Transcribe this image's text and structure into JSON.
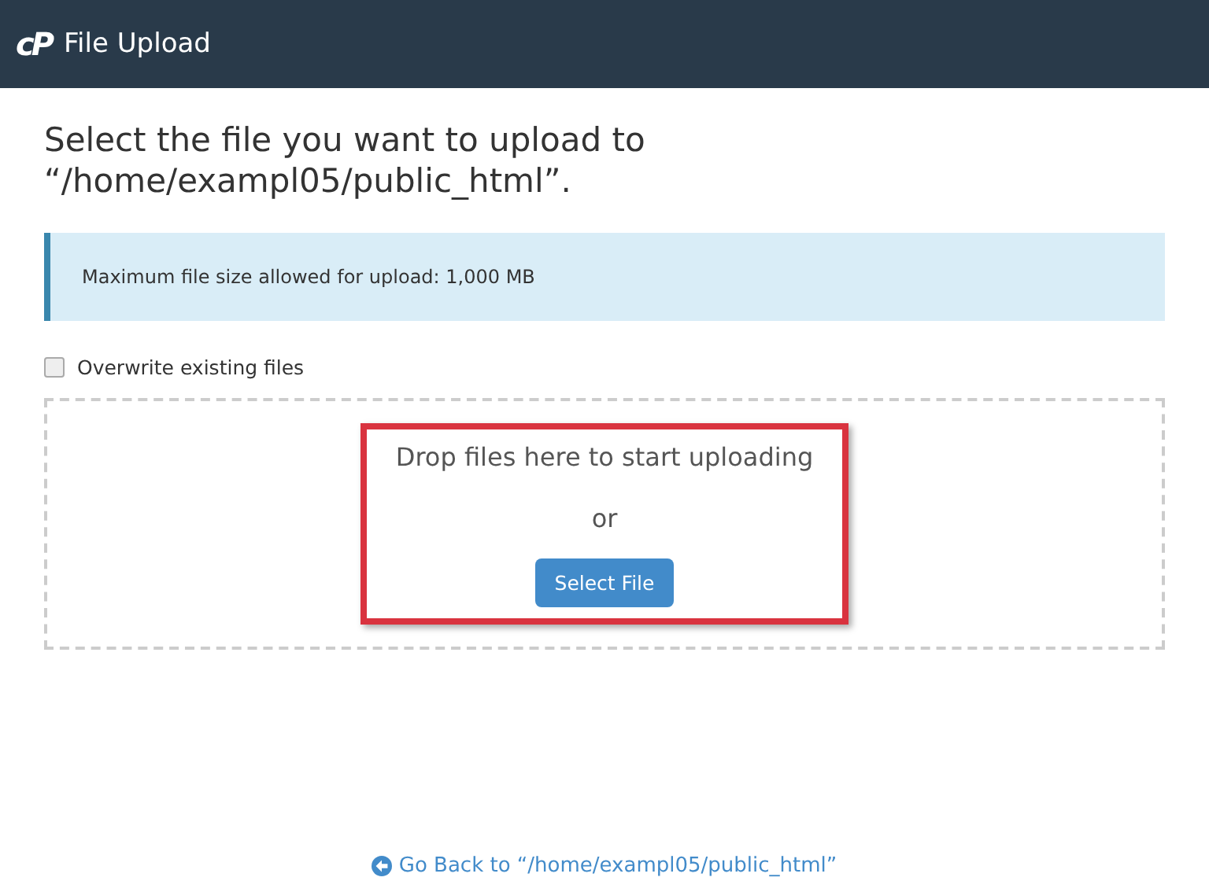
{
  "header": {
    "logo": "cP",
    "title": "File Upload"
  },
  "heading": "Select the file you want to upload to “/home/exampl05/public_html”.",
  "alert": "Maximum file size allowed for upload: 1,000 MB",
  "overwrite": {
    "label": "Overwrite existing files",
    "checked": false
  },
  "dropzone": {
    "prompt": "Drop files here to start uploading",
    "or": "or",
    "button": "Select File",
    "highlighted": true
  },
  "back_link": "Go Back to “/home/exampl05/public_html”"
}
